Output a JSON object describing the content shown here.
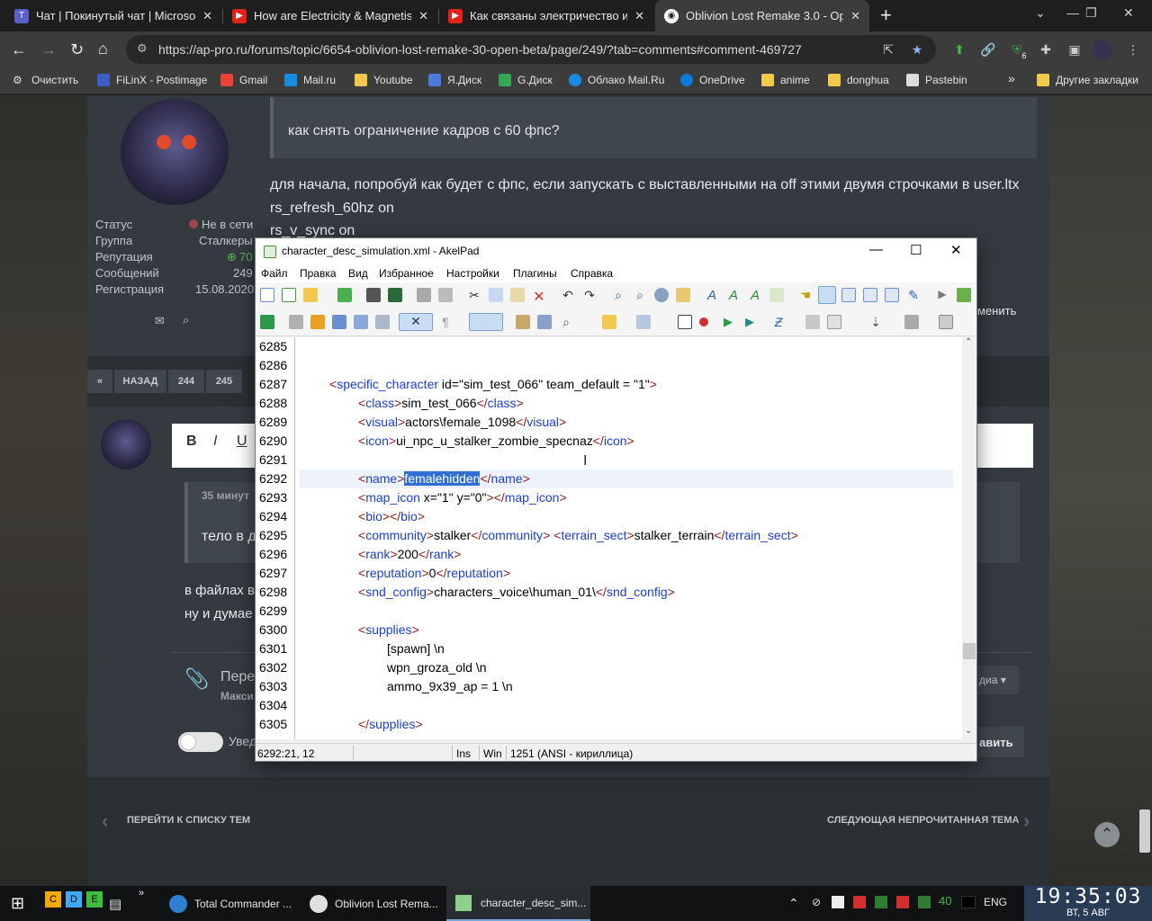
{
  "browser": {
    "tabs": [
      {
        "title": "Чат | Покинутый чат | Microsoft",
        "favicon": "teams-icon"
      },
      {
        "title": "How are Electricity & Magnetism",
        "favicon": "youtube-icon"
      },
      {
        "title": "Как связаны электричество и м",
        "favicon": "youtube-icon"
      },
      {
        "title": "Oblivion Lost Remake 3.0 - Oper",
        "favicon": "apro-icon"
      }
    ],
    "url": "https://ap-pro.ru/forums/topic/6654-oblivion-lost-remake-30-open-beta/page/249/?tab=comments#comment-469727",
    "bookmarks": [
      "Очистить",
      "FiLinX - Postimage",
      "Gmail",
      "Mail.ru",
      "Youtube",
      "Я.Диск",
      "G.Диск",
      "Облако Mail.Ru",
      "OneDrive",
      "anime",
      "donghua",
      "Pastebin"
    ],
    "other_bookmarks": "Другие закладки",
    "more": "»",
    "ext_badge": "6"
  },
  "forum": {
    "profile": {
      "labels": [
        "Статус",
        "Группа",
        "Репутация",
        "Сообщений",
        "Регистрация"
      ],
      "values": [
        "Не в сети",
        "Сталкеры",
        "70",
        "249",
        "15.08.2020"
      ]
    },
    "quote": "как снять ограничение кадров с 60 фпс?",
    "post_lines": [
      "для начала, попробуй как будет с фпс, если запускать с выставленными на off этими двумя строчками в user.ltx",
      "rs_refresh_60hz on",
      "rs_v_sync on"
    ],
    "pagination": [
      "«",
      "НАЗАД",
      "244",
      "245"
    ],
    "reply_quote_time": "35 минут",
    "reply_quote_text": "тело в д",
    "reply_lines": [
      "в файлах в",
      "ну и думае"
    ],
    "attach_label": "Пере",
    "attach_sub": "Макси",
    "notify_label": "Увед",
    "media_button": "диа ▾",
    "submit_button": "авить",
    "edit_link": "менить",
    "nav_prev": "ПЕРЕЙТИ К СПИСКУ ТЕМ",
    "nav_next": "СЛЕДУЮЩАЯ НЕПРОЧИТАННАЯ ТЕМА"
  },
  "akelpad": {
    "title": "character_desc_simulation.xml - AkelPad",
    "menu": [
      "Файл",
      "Правка",
      "Вид",
      "Избранное",
      "Настройки",
      "Плагины",
      "Справка"
    ],
    "line_numbers": [
      "6285",
      "6286",
      "6287",
      "6288",
      "6289",
      "6290",
      "6291",
      "6292",
      "6293",
      "6294",
      "6295",
      "6296",
      "6297",
      "6298",
      "6299",
      "6300",
      "6301",
      "6302",
      "6303",
      "6304",
      "6305"
    ],
    "code": {
      "l6287_a": "<",
      "l6287_tag": "specific_character",
      "l6287_rest": " id=\"sim_test_066\" team_default = \"1\"",
      "l6287_end": ">",
      "l6288": [
        "<",
        "class",
        ">",
        "sim_test_066",
        "</",
        "class",
        ">"
      ],
      "l6289": [
        "<",
        "visual",
        ">",
        "actors\\female_1098",
        "</",
        "visual",
        ">"
      ],
      "l6290": [
        "<",
        "icon",
        ">",
        "ui_npc_u_stalker_zombie_specnaz",
        "</",
        "icon",
        ">"
      ],
      "l6292": [
        "<",
        "name",
        ">",
        "femalehidden",
        "</",
        "name",
        ">"
      ],
      "l6293": [
        "<",
        "map_icon",
        " x=\"1\" y=\"0\"",
        "></",
        "map_icon",
        ">"
      ],
      "l6294": [
        "<",
        "bio",
        "></",
        "bio",
        ">"
      ],
      "l6295": [
        "<",
        "community",
        ">",
        "stalker",
        "</",
        "community",
        "> <",
        "terrain_sect",
        ">",
        "stalker_terrain",
        "</",
        "terrain_sect",
        ">"
      ],
      "l6296": [
        "<",
        "rank",
        ">",
        "200",
        "</",
        "rank",
        ">"
      ],
      "l6297": [
        "<",
        "reputation",
        ">",
        "0",
        "</",
        "reputation",
        ">"
      ],
      "l6298": [
        "<",
        "snd_config",
        ">",
        "characters_voice\\human_01\\",
        "</",
        "snd_config",
        ">"
      ],
      "l6300": [
        "<",
        "supplies",
        ">"
      ],
      "l6301": "[spawn] \\n",
      "l6302": "wpn_groza_old \\n",
      "l6303": "ammo_9x39_ap = 1 \\n",
      "l6305": [
        "</",
        "supplies",
        ">"
      ]
    },
    "status": {
      "pos": "6292:21, 12",
      "mode": "Ins",
      "eol": "Win",
      "codepage": "1251  (ANSI - кириллица)"
    }
  },
  "taskbar": {
    "items": [
      "Total Commander ...",
      "Oblivion Lost Rema...",
      "character_desc_sim..."
    ],
    "quick": [
      "C",
      "D",
      "E"
    ],
    "tray_num": "40",
    "lang": "ENG",
    "time": "19:35:03",
    "date": "ВТ, 5  АВГ"
  },
  "colors": {
    "accent": "#2f6fd3",
    "tag": "#8b1a1a",
    "tagname": "#1a3fcc",
    "chrome": "#3c3c3c"
  }
}
